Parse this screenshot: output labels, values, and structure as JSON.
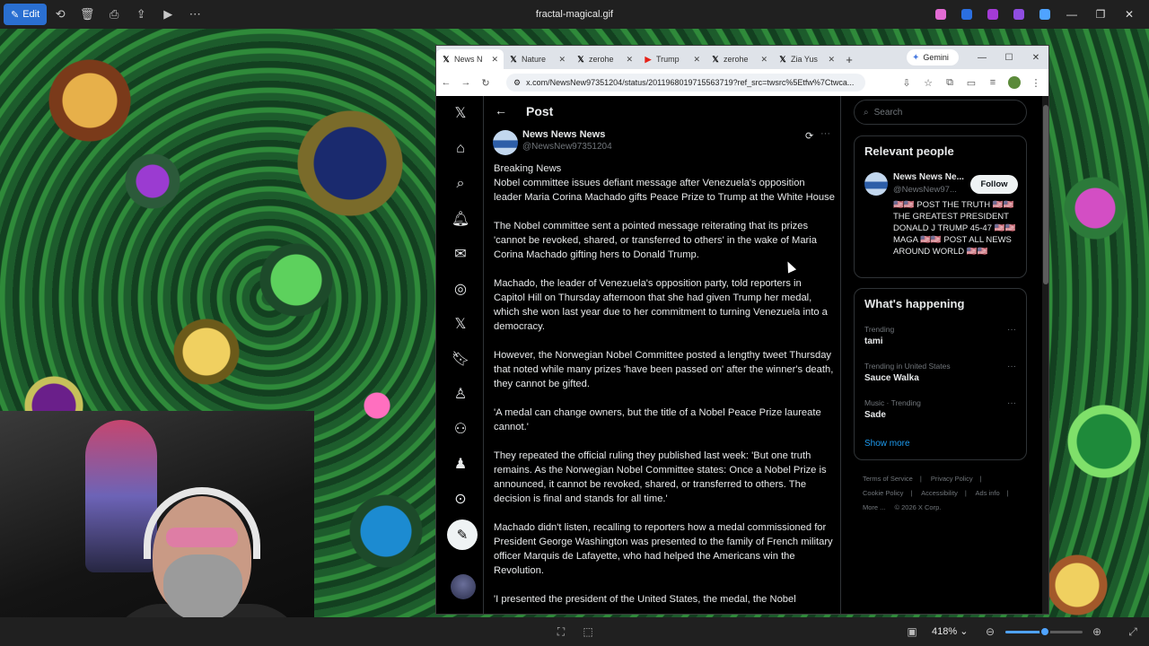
{
  "viewer": {
    "edit_label": "Edit",
    "file_name": "fractal-magical.gif",
    "zoom": "418%",
    "icons": [
      "rotate-icon",
      "delete-icon",
      "print-icon",
      "share-icon",
      "slideshow-icon",
      "more-icon"
    ]
  },
  "browser": {
    "tabs": [
      {
        "label": "News N",
        "icon": "x-icon",
        "active": true
      },
      {
        "label": "Nature",
        "icon": "x-icon",
        "active": false
      },
      {
        "label": "zerohe",
        "icon": "x-icon",
        "active": false
      },
      {
        "label": "Trump",
        "icon": "youtube-icon",
        "active": false
      },
      {
        "label": "zerohe",
        "icon": "x-icon",
        "active": false
      },
      {
        "label": "Zia Yus",
        "icon": "x-icon",
        "active": false
      }
    ],
    "gemini_label": "Gemini",
    "url": "x.com/NewsNew97351204/status/2011968019715563719?ref_src=twsrc%5Etfw%7Ctwca..."
  },
  "x": {
    "page_title": "Post",
    "post": {
      "name": "News News News",
      "handle": "@NewsNew97351204",
      "paragraphs": [
        "Breaking News",
        "Nobel committee issues defiant message after Venezuela's opposition leader Maria Corina Machado gifts Peace Prize to Trump at the White House",
        "The Nobel committee sent a pointed message reiterating that its prizes 'cannot be revoked, shared, or transferred to others' in the wake of Maria Corina Machado gifting hers to Donald Trump.",
        "Machado, the leader of Venezuela's opposition party, told reporters in Capitol Hill on Thursday afternoon that she had given Trump her medal, which she won last year due to her commitment to turning Venezuela into a democracy.",
        "However, the Norwegian Nobel Committee posted a lengthy tweet Thursday that noted while many prizes 'have been passed on' after the winner's death, they cannot be gifted.",
        "'A medal can change owners, but the title of a Nobel Peace Prize laureate cannot.'",
        "They repeated the official ruling they published last week: 'But one truth remains. As the Norwegian Nobel Committee states: Once a Nobel Prize is announced, it cannot be revoked, shared, or transferred to others. The decision is final and stands for all time.'",
        "Machado didn't listen, recalling to reporters how a medal commissioned for President George Washington was presented to the family of French military officer Marquis de Lafayette, who had helped the Americans win the Revolution.",
        "'I presented the president of the United States, the medal, the Nobel"
      ]
    },
    "search_placeholder": "Search",
    "relevant": {
      "title": "Relevant people",
      "name": "News News Ne...",
      "handle": "@NewsNew97...",
      "follow_label": "Follow",
      "bio": "🇺🇸🇺🇸 POST THE TRUTH 🇺🇸🇺🇸THE GREATEST PRESIDENT DONALD J TRUMP 45-47 🇺🇸🇺🇸 MAGA 🇺🇸🇺🇸 POST ALL NEWS AROUND WORLD 🇺🇸🇺🇸"
    },
    "happening": {
      "title": "What's happening",
      "trends": [
        {
          "meta": "Trending",
          "name": "tami"
        },
        {
          "meta": "Trending in United States",
          "name": "Sauce Walka"
        },
        {
          "meta": "Music · Trending",
          "name": "Sade"
        }
      ],
      "show_more": "Show more"
    },
    "footer": {
      "links": [
        "Terms of Service",
        "|",
        "Privacy Policy",
        "|",
        "Cookie Policy",
        "|",
        "Accessibility",
        "|",
        "Ads info",
        "|",
        "More ...",
        "© 2026 X Corp."
      ]
    }
  }
}
